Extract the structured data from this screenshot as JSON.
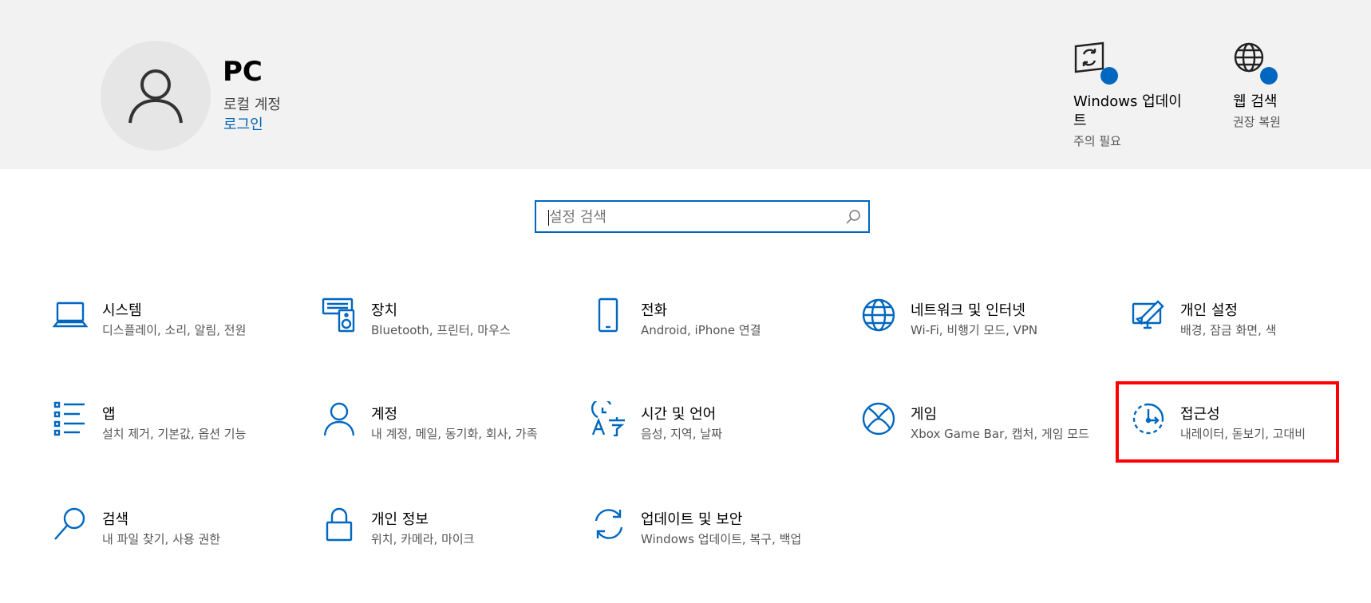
{
  "user": {
    "name": "PC",
    "account_type": "로컬 계정",
    "login_link": "로그인"
  },
  "header_cards": [
    {
      "icon": "windows-update-icon",
      "title": "Windows 업데이트",
      "subtitle": "주의 필요"
    },
    {
      "icon": "globe-icon",
      "title": "웹 검색",
      "subtitle": "권장 복원"
    }
  ],
  "search": {
    "placeholder": "설정 검색",
    "value": ""
  },
  "categories": [
    {
      "icon": "laptop-icon",
      "title": "시스템",
      "subtitle": "디스플레이, 소리, 알림, 전원"
    },
    {
      "icon": "devices-icon",
      "title": "장치",
      "subtitle": "Bluetooth, 프린터, 마우스"
    },
    {
      "icon": "phone-icon",
      "title": "전화",
      "subtitle": "Android, iPhone 연결"
    },
    {
      "icon": "globe-icon",
      "title": "네트워크 및 인터넷",
      "subtitle": "Wi-Fi, 비행기 모드, VPN"
    },
    {
      "icon": "personalization-icon",
      "title": "개인 설정",
      "subtitle": "배경, 잠금 화면, 색"
    },
    {
      "icon": "apps-icon",
      "title": "앱",
      "subtitle": "설치 제거, 기본값, 옵션 기능"
    },
    {
      "icon": "person-icon",
      "title": "계정",
      "subtitle": "내 계정, 메일, 동기화, 회사, 가족"
    },
    {
      "icon": "time-language-icon",
      "title": "시간 및 언어",
      "subtitle": "음성, 지역, 날짜"
    },
    {
      "icon": "xbox-icon",
      "title": "게임",
      "subtitle": "Xbox Game Bar, 캡처, 게임 모드"
    },
    {
      "icon": "accessibility-icon",
      "title": "접근성",
      "subtitle": "내레이터, 돋보기, 고대비"
    },
    {
      "icon": "search-icon",
      "title": "검색",
      "subtitle": "내 파일 찾기, 사용 권한"
    },
    {
      "icon": "lock-icon",
      "title": "개인 정보",
      "subtitle": "위치, 카메라, 마이크"
    },
    {
      "icon": "update-security-icon",
      "title": "업데이트 및 보안",
      "subtitle": "Windows 업데이트, 복구, 백업"
    }
  ],
  "colors": {
    "accent": "#0067c0",
    "header_bg": "#f2f2f2",
    "highlight": "#ff0000"
  }
}
